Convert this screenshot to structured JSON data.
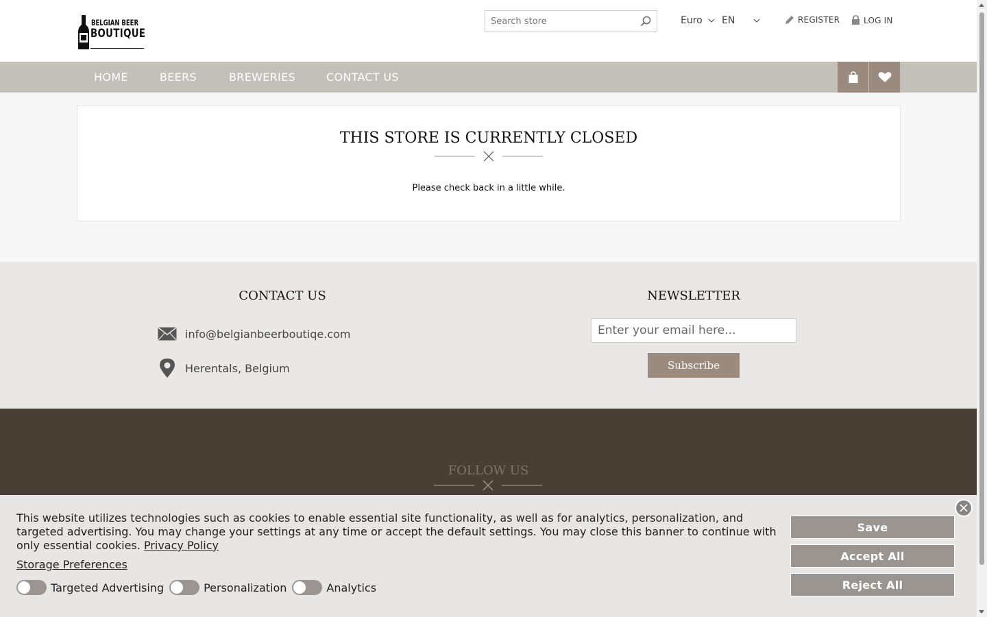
{
  "header": {
    "logo_line1": "BELGIAN BEER",
    "logo_line2": "BOUTIQUE",
    "search_placeholder": "Search store",
    "currency": "Euro",
    "language": "EN",
    "register_label": "REGISTER",
    "login_label": "LOG IN"
  },
  "nav": {
    "items": [
      "HOME",
      "BEERS",
      "BREWERIES",
      "CONTACT US"
    ]
  },
  "main": {
    "title": "THIS STORE IS CURRENTLY CLOSED",
    "message": "Please check back in a little while."
  },
  "footer": {
    "contact_title": "CONTACT US",
    "email": "info@belgianbeerboutiqe.com",
    "location": "Herentals, Belgium",
    "newsletter_title": "NEWSLETTER",
    "newsletter_placeholder": "Enter your email here...",
    "subscribe_label": "Subscribe",
    "follow_title": "FOLLOW US"
  },
  "cookie": {
    "text": "This website utilizes technologies such as cookies to enable essential site functionality, as well as for analytics, personalization, and targeted advertising. You may change your settings at any time or accept the default settings. You may close this banner to continue with only essential cookies.",
    "privacy_link": "Privacy Policy",
    "storage_preferences": "Storage Preferences",
    "toggles": [
      "Targeted Advertising",
      "Personalization",
      "Analytics"
    ],
    "save_label": "Save",
    "accept_label": "Accept All",
    "reject_label": "Reject All"
  },
  "colors": {
    "nav_bg": "#c3bfb9",
    "accent": "#9b8b7e",
    "footer_dark": "#4a3f35",
    "footer_light": "#eae8e6",
    "cookie_button": "#9a9590"
  }
}
